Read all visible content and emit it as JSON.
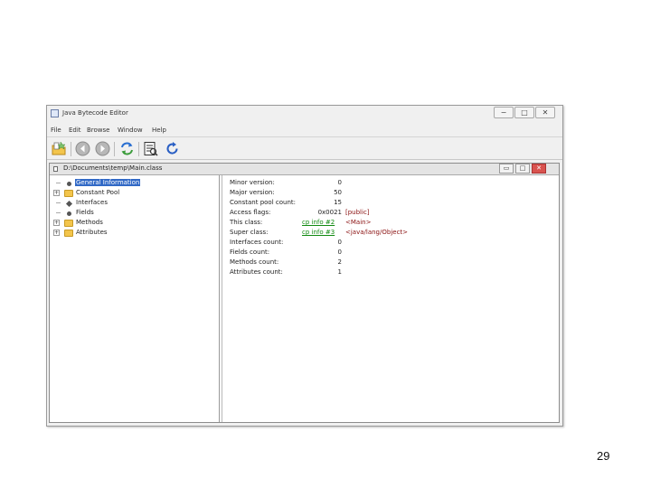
{
  "window": {
    "title": "Java Bytecode Editor",
    "minimize": "−",
    "maximize": "□",
    "close": "✕"
  },
  "menu": [
    "File",
    "Edit",
    "Browse",
    "Window",
    "Help"
  ],
  "toolbar": {
    "buttons": [
      "open-icon",
      "back-icon",
      "forward-icon",
      "refresh-icon",
      "details-icon",
      "reload-icon"
    ]
  },
  "editor": {
    "path": "D:\\Documents\\temp\\Main.class",
    "minimize_label": "▭",
    "close_label": "✕"
  },
  "tree": [
    {
      "label": "General Information",
      "icon": "bullet",
      "selected": true
    },
    {
      "label": "Constant Pool",
      "icon": "folder",
      "expandable": true
    },
    {
      "label": "Interfaces",
      "icon": "diamond"
    },
    {
      "label": "Fields",
      "icon": "bullet"
    },
    {
      "label": "Methods",
      "icon": "folder",
      "expandable": true
    },
    {
      "label": "Attributes",
      "icon": "folder",
      "expandable": true
    }
  ],
  "properties": [
    {
      "label": "Minor version:",
      "value": "0"
    },
    {
      "label": "Major version:",
      "value": "50"
    },
    {
      "label": "Constant pool count:",
      "value": "15"
    },
    {
      "label": "Access flags:",
      "value": "0x0021",
      "extra": "[public]"
    },
    {
      "label": "This class:",
      "link": "cp info #2",
      "extra": "<Main>"
    },
    {
      "label": "Super class:",
      "link": "cp info #3",
      "extra": "<java/lang/Object>"
    },
    {
      "label": "Interfaces count:",
      "value": "0"
    },
    {
      "label": "Fields count:",
      "value": "0"
    },
    {
      "label": "Methods count:",
      "value": "2"
    },
    {
      "label": "Attributes count:",
      "value": "1"
    }
  ],
  "page_number": "29"
}
